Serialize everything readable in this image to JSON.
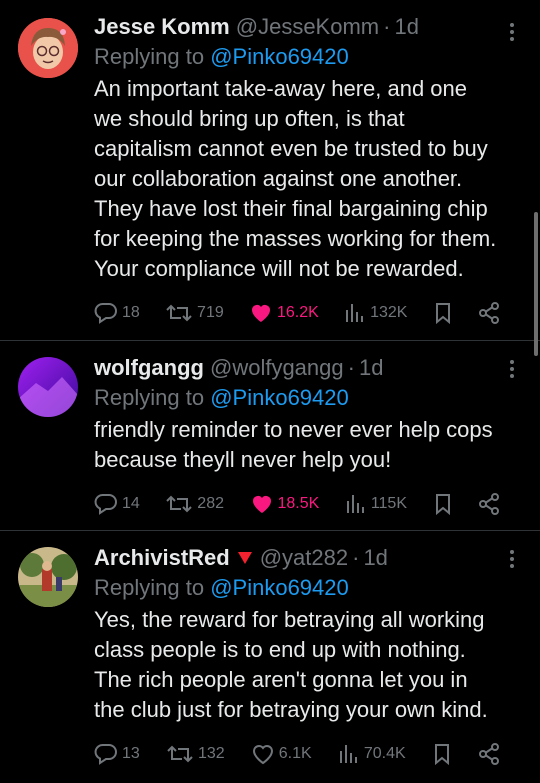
{
  "tweets": [
    {
      "name": "Jesse Komm",
      "handle": "@JesseKomm",
      "time": "1d",
      "replying_prefix": "Replying to",
      "replying_to": "@Pinko69420",
      "text": "An important take-away here, and one we should bring up often, is that capitalism cannot even be trusted to buy our collaboration against one another. They have lost their final bargaining chip for keeping the masses working for them. Your compliance will not be rewarded.",
      "replies": "18",
      "retweets": "719",
      "likes": "16.2K",
      "views": "132K",
      "liked": true
    },
    {
      "name": "wolfgangg",
      "handle": "@wolfygangg",
      "time": "1d",
      "replying_prefix": "Replying to",
      "replying_to": "@Pinko69420",
      "text": "friendly reminder to never ever help cops because theyll never help you!",
      "replies": "14",
      "retweets": "282",
      "likes": "18.5K",
      "views": "115K",
      "liked": true
    },
    {
      "name": "ArchivistRed",
      "handle": "@yat282",
      "time": "1d",
      "replying_prefix": "Replying to",
      "replying_to": "@Pinko69420",
      "text": "Yes, the reward for betraying all working class people is to end up with nothing. The rich people aren't gonna let you in the club just for betraying your own kind.",
      "replies": "13",
      "retweets": "132",
      "likes": "6.1K",
      "views": "70.4K",
      "liked": false
    }
  ],
  "colors": {
    "accent": "#1d9bf0",
    "like": "#f91880",
    "muted": "#71767b",
    "flag": "#f4212e"
  }
}
